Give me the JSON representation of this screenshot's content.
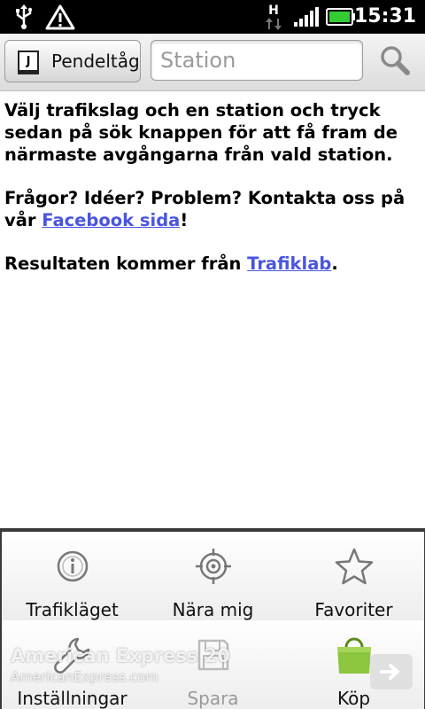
{
  "status_bar": {
    "time": "15:31",
    "network_type": "H",
    "icons": [
      "usb-icon",
      "warning-icon",
      "network-data-icon",
      "signal-icon",
      "battery-icon"
    ]
  },
  "toolbar": {
    "mode_label": "Pendeltåg",
    "mode_icon_letter": "J",
    "station_placeholder": "Station",
    "station_value": "",
    "search_icon": "search-icon"
  },
  "content": {
    "intro": "Välj trafikslag och en station och tryck sedan på sök knappen för att få fram de närmaste avgångarna från vald station.",
    "contact_prefix": "Frågor? Idéer? Problem? Kontakta oss på vår ",
    "contact_link": "Facebook sida",
    "contact_suffix": "!",
    "source_prefix": "Resultaten kommer från ",
    "source_link": "Trafiklab",
    "source_suffix": "."
  },
  "menu": {
    "items": [
      {
        "label": "Trafikläget",
        "icon": "info-icon",
        "enabled": true
      },
      {
        "label": "Nära mig",
        "icon": "location-target-icon",
        "enabled": true
      },
      {
        "label": "Favoriter",
        "icon": "star-icon",
        "enabled": true
      },
      {
        "label": "Inställningar",
        "icon": "wrench-icon",
        "enabled": true
      },
      {
        "label": "Spara",
        "icon": "save-icon",
        "enabled": false
      },
      {
        "label": "Köp",
        "icon": "market-bag-icon",
        "enabled": true
      }
    ]
  },
  "ad": {
    "title": "American Express 20",
    "url": "AmericanExpress.com"
  },
  "colors": {
    "link": "#4a55e0",
    "battery": "#33cc33",
    "status_bar": "#000000"
  }
}
